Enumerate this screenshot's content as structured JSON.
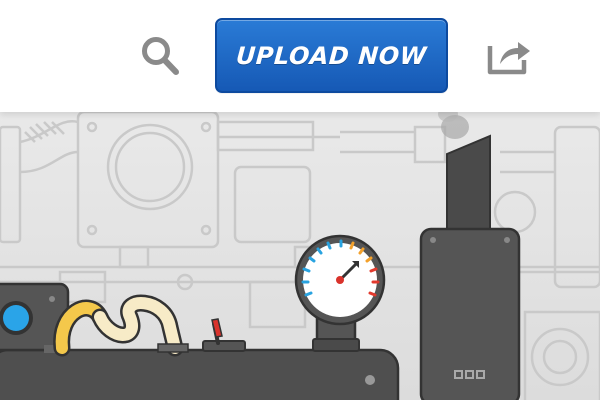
{
  "header": {
    "upload_label": "UPLOAD NOW",
    "search_icon": "search-icon",
    "share_icon": "share-icon"
  },
  "colors": {
    "upload_button": "#1c67c4",
    "icon_gray": "#8a8a8a",
    "scene_background": "#e6e6e6",
    "machine_dark": "#4a4a4a",
    "pipe_yellow": "#f4c84b"
  },
  "illustration": {
    "description_icon": "factory-machine-illustration",
    "gauge_icon": "pressure-gauge-icon",
    "switch_icon": "toggle-lever-icon",
    "chimney_icon": "smoke-chimney-icon"
  }
}
